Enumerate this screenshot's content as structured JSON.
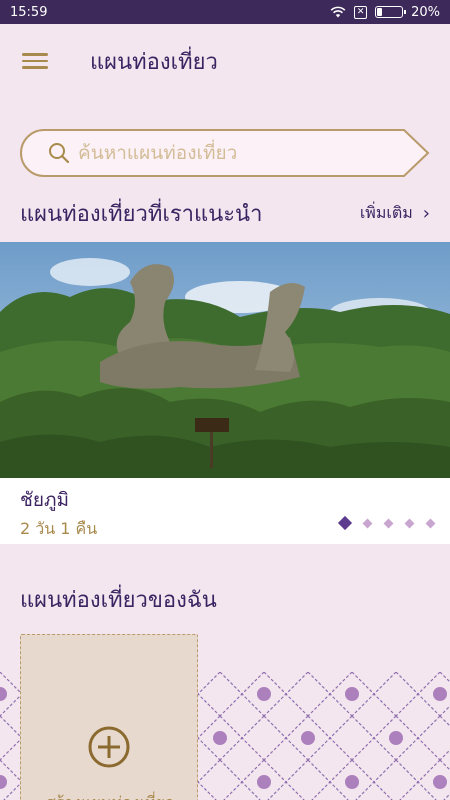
{
  "status_bar": {
    "time": "15:59",
    "battery": "20%",
    "battery_level": 0.2
  },
  "app_bar": {
    "title": "แผนท่องเที่ยว"
  },
  "search": {
    "placeholder": "ค้นหาแผนท่องเที่ยว"
  },
  "recommended": {
    "title": "แผนท่องเที่ยวที่เราแนะนำ",
    "more_label": "เพิ่มเติม",
    "card": {
      "name": "ชัยภูมิ",
      "duration": "2 วัน 1 คืน",
      "page_count": 5,
      "active_page": 1
    }
  },
  "my_plans": {
    "title": "แผนท่องเที่ยวของฉัน",
    "add_label": "สร้างแผนท่องเที่ยว"
  },
  "colors": {
    "status_bar": "#3d2a5a",
    "background": "#f3e6ef",
    "accent_gold": "#a88a4d",
    "text_purple": "#3c2462",
    "dot_active": "#5d3b8e",
    "dot_inactive": "#c9a6d0"
  },
  "icons": {
    "menu": "hamburger-icon",
    "search": "search-icon",
    "more": "chevron-right-icon",
    "add": "plus-circle-icon",
    "wifi": "wifi-icon",
    "sim": "no-sim-icon",
    "battery": "battery-icon"
  }
}
